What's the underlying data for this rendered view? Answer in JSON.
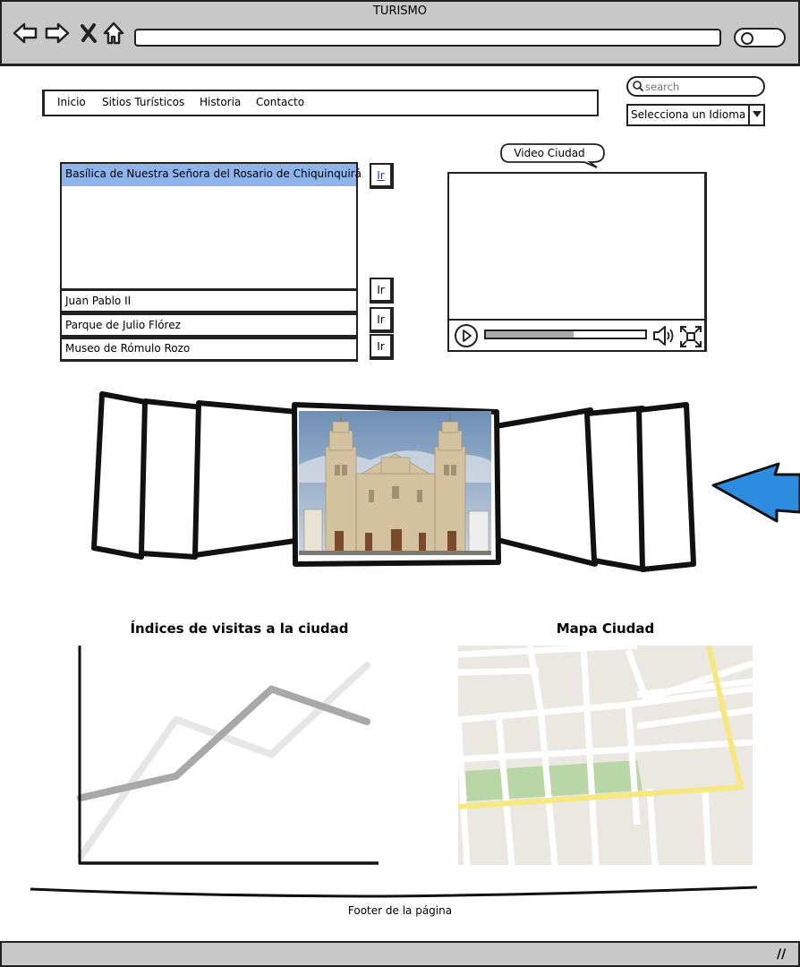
{
  "window": {
    "title": "TURISMO"
  },
  "menu": {
    "items": [
      "Inicio",
      "Sitios Turísticos",
      "Historia",
      "Contacto"
    ]
  },
  "search": {
    "placeholder": "search"
  },
  "language": {
    "selected": "Selecciona un Idioma"
  },
  "sites": {
    "selected": "Basílica de Nuestra Señora del Rosario de Chiquinquirá",
    "rows": [
      "Juan Pablo II",
      "Parque de Julio Flórez",
      "Museo de Rómulo Rozo"
    ],
    "go_label": "Ir"
  },
  "video": {
    "title": "Video Ciudad",
    "progress": 0.55
  },
  "carousel": {
    "image": "basilica-photo"
  },
  "chart": {
    "title": "Índices de visitas a la ciudad"
  },
  "chart_data": {
    "type": "line",
    "title": "Índices de visitas a la ciudad",
    "xlabel": "",
    "ylabel": "",
    "x": [
      0,
      1,
      2,
      3
    ],
    "ylim": [
      0,
      10
    ],
    "grid": false,
    "series": [
      {
        "values": [
          3.0,
          4.0,
          8.0,
          6.5
        ],
        "color": "#a8a8a8"
      },
      {
        "values": [
          0.3,
          6.6,
          5.0,
          9.1
        ],
        "color": "#e6e6e6"
      }
    ]
  },
  "map": {
    "title": "Mapa Ciudad"
  },
  "footer": {
    "text": "Footer de la página"
  },
  "colors": {
    "chrome": "#c8c8c8",
    "selection": "#8fb4ec",
    "arrow": "#2d8ce0",
    "map_bg": "#ebe8e2",
    "map_park": "#b9d7a6",
    "map_road": "#f6e77f"
  }
}
